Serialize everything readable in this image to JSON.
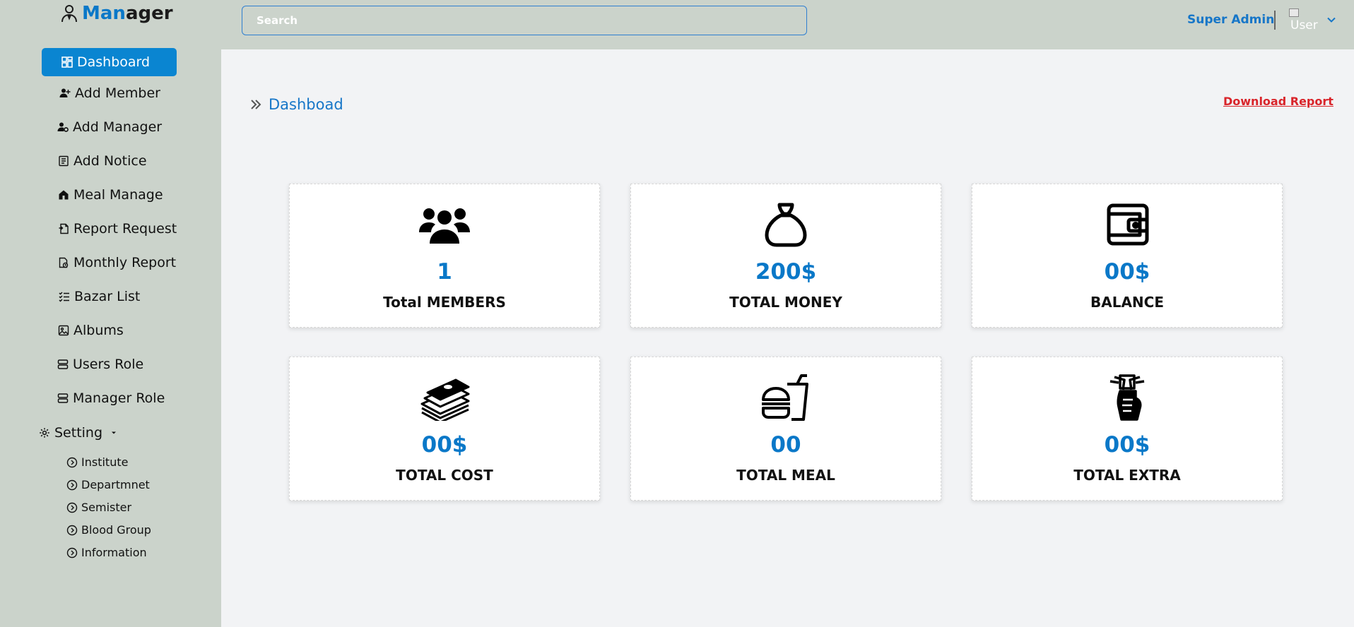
{
  "logo": {
    "part1": "Man",
    "part2": "ager"
  },
  "search": {
    "placeholder": "Search"
  },
  "header": {
    "admin_name": "Super Admin",
    "avatar_alt": "User"
  },
  "sidebar": {
    "items": [
      {
        "label": "Dashboard"
      },
      {
        "label": "Add Member"
      },
      {
        "label": "Add Manager"
      },
      {
        "label": "Add Notice"
      },
      {
        "label": "Meal Manage"
      },
      {
        "label": "Report Request"
      },
      {
        "label": "Monthly Report"
      },
      {
        "label": "Bazar List"
      },
      {
        "label": "Albums"
      },
      {
        "label": "Users Role"
      },
      {
        "label": "Manager Role"
      }
    ],
    "setting": {
      "label": "Setting"
    },
    "sub_items": [
      {
        "label": "Institute"
      },
      {
        "label": "Departmnet"
      },
      {
        "label": "Semister"
      },
      {
        "label": "Blood Group"
      },
      {
        "label": "Information"
      }
    ]
  },
  "breadcrumb": {
    "title": "Dashboad"
  },
  "download_label": "Download Report",
  "cards": [
    {
      "value": "1",
      "label": "Total MEMBERS",
      "icon": "users-icon"
    },
    {
      "value": "200$",
      "label": "TOTAL MONEY",
      "icon": "money-bag-icon"
    },
    {
      "value": "00$",
      "label": "BALANCE",
      "icon": "wallet-icon"
    },
    {
      "value": "00$",
      "label": "TOTAL COST",
      "icon": "cash-stack-icon"
    },
    {
      "value": "00",
      "label": "TOTAL MEAL",
      "icon": "burger-drink-icon"
    },
    {
      "value": "00$",
      "label": "TOTAL EXTRA",
      "icon": "money-hand-icon"
    }
  ],
  "colors": {
    "accent": "#0a85d1",
    "sidebar_bg": "#cbd3cb",
    "danger": "#d9242a"
  }
}
